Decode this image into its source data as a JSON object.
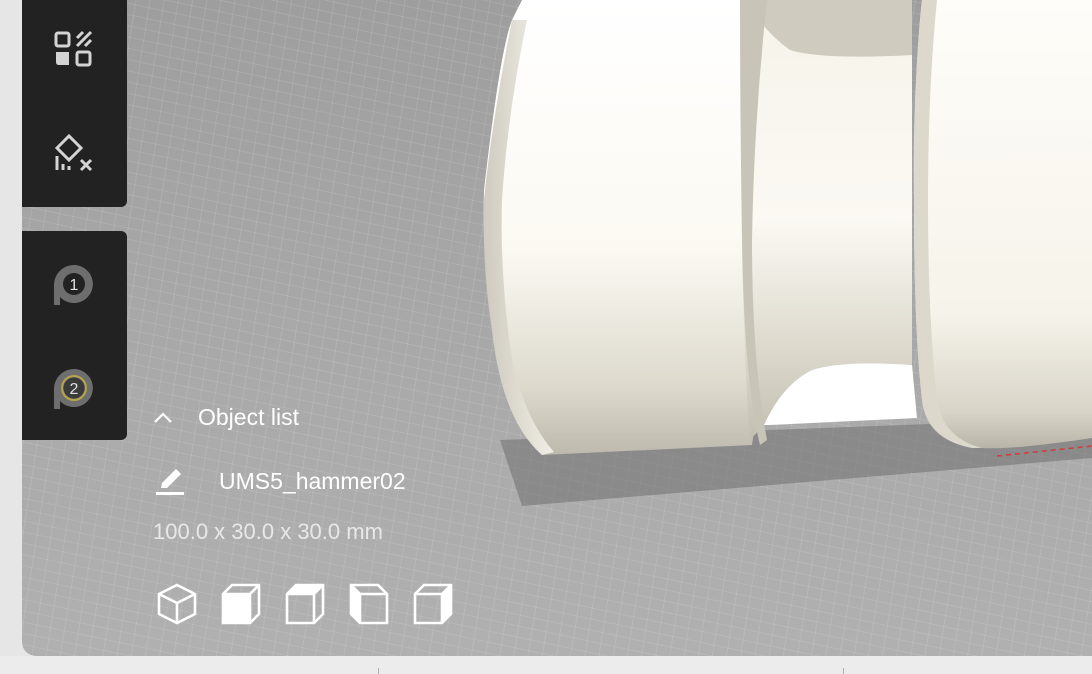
{
  "object_list": {
    "toggle_label": "Object list",
    "object_name": "UMS5_hammer02",
    "dimensions": "100.0 x 30.0 x 30.0 mm"
  },
  "tools": {
    "top": [
      "support-blocker-icon",
      "per-model-settings-icon"
    ],
    "extruders": [
      {
        "number": "1",
        "icon": "extruder-1-icon",
        "state": "inactive"
      },
      {
        "number": "2",
        "icon": "extruder-2-icon",
        "state": "active"
      }
    ]
  },
  "view_buttons": [
    "3d-view-icon",
    "front-view-icon",
    "top-view-icon",
    "left-view-icon",
    "right-view-icon"
  ],
  "colors": {
    "panel": "#222222",
    "build_plate": "#a9a9a9",
    "model": "#f3f0e6",
    "extruder_2_ring": "#b5a54a"
  }
}
